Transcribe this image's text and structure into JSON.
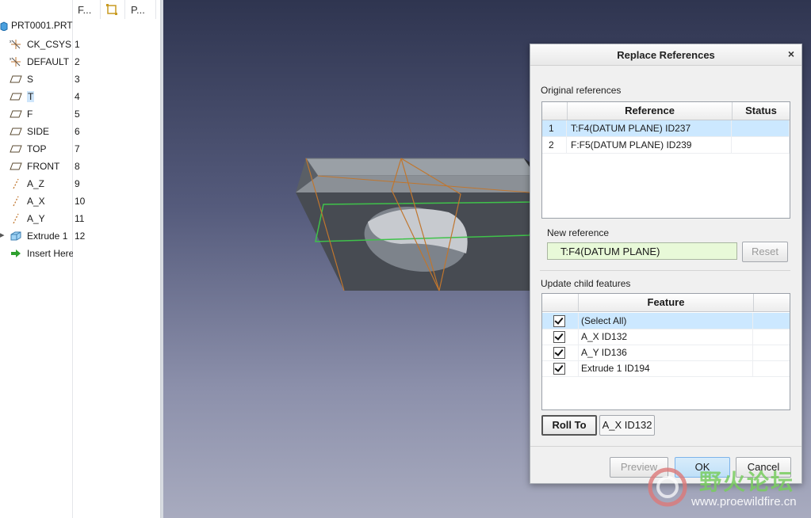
{
  "model_tree": {
    "columns": [
      "F...",
      "",
      "P..."
    ],
    "root": "PRT0001.PRT",
    "items": [
      {
        "label": "CK_CSYS",
        "num": "1",
        "icon": "csys-icon"
      },
      {
        "label": "DEFAULT",
        "num": "2",
        "icon": "csys-icon"
      },
      {
        "label": "S",
        "num": "3",
        "icon": "datum-plane-icon"
      },
      {
        "label": "T",
        "num": "4",
        "icon": "datum-plane-icon"
      },
      {
        "label": "F",
        "num": "5",
        "icon": "datum-plane-icon"
      },
      {
        "label": "SIDE",
        "num": "6",
        "icon": "datum-plane-icon"
      },
      {
        "label": "TOP",
        "num": "7",
        "icon": "datum-plane-icon"
      },
      {
        "label": "FRONT",
        "num": "8",
        "icon": "datum-plane-icon"
      },
      {
        "label": "A_Z",
        "num": "9",
        "icon": "datum-axis-icon"
      },
      {
        "label": "A_X",
        "num": "10",
        "icon": "datum-axis-icon"
      },
      {
        "label": "A_Y",
        "num": "11",
        "icon": "datum-axis-icon"
      },
      {
        "label": "Extrude 1",
        "num": "12",
        "icon": "extrude-icon"
      },
      {
        "label": "Insert Here",
        "num": "",
        "icon": "insert-arrow-icon"
      }
    ]
  },
  "dialog": {
    "title": "Replace References",
    "close": "×",
    "original_label": "Original references",
    "ref_columns": [
      "Reference",
      "Status"
    ],
    "references": [
      {
        "idx": "1",
        "ref": "T:F4(DATUM PLANE) ID237",
        "status": ""
      },
      {
        "idx": "2",
        "ref": "F:F5(DATUM PLANE) ID239",
        "status": ""
      }
    ],
    "new_ref_label": "New reference",
    "new_ref_value": "T:F4(DATUM PLANE)",
    "reset_label": "Reset",
    "update_label": "Update child features",
    "feature_column": "Feature",
    "features": [
      "(Select All)",
      "A_X ID132",
      "A_Y ID136",
      "Extrude 1 ID194"
    ],
    "roll_to_label": "Roll To",
    "roll_to_value": "A_X ID132",
    "preview_label": "Preview",
    "ok_label": "OK",
    "cancel_label": "Cancel"
  },
  "watermark": {
    "text_cn": "野火论坛",
    "url": "www.proewildfire.cn"
  },
  "colors": {
    "selection": "#cce8ff",
    "new_ref_bg": "#e8f9d8",
    "viewport_top": "#2f3550",
    "viewport_bottom": "#a8abbf"
  }
}
